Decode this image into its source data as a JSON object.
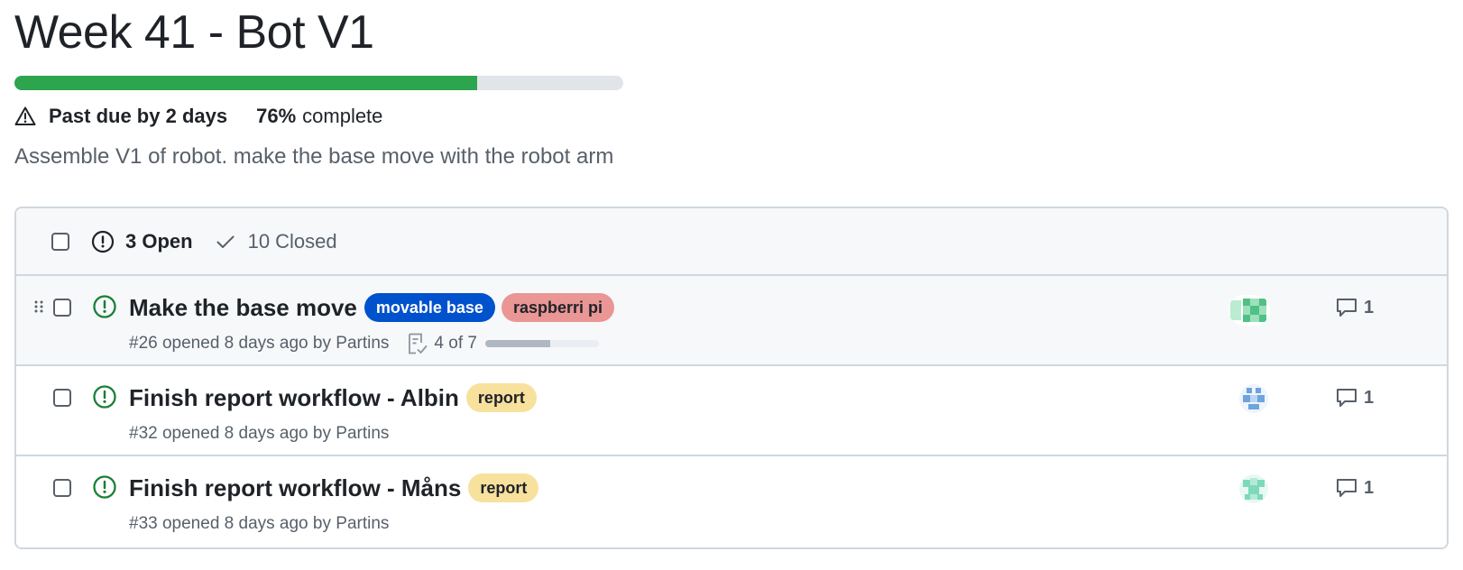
{
  "milestone": {
    "title": "Week 41 - Bot V1",
    "progress_fraction": 0.76,
    "due_status": "Past due by 2 days",
    "percent": "76%",
    "percent_suffix": "complete",
    "description": "Assemble V1 of robot. make the base move with the robot arm"
  },
  "colors": {
    "progress_green": "#2da44e",
    "open_icon_green": "#1a7f37",
    "border": "#d0d7de"
  },
  "filters": {
    "open_label": "3 Open",
    "closed_label": "10 Closed"
  },
  "issues": [
    {
      "title": "Make the base move",
      "labels": [
        {
          "text": "movable base",
          "bg": "#0052cc",
          "fg": "#ffffff"
        },
        {
          "text": "raspberri pi",
          "bg": "#e99695",
          "fg": "#1f2328"
        }
      ],
      "number": "#26",
      "meta": "opened 8 days ago by",
      "author": "Partins",
      "tasks": "4 of 7",
      "tasks_fraction": 0.571,
      "comments": "1",
      "avatar_icon": "identicon-green"
    },
    {
      "title": "Finish report workflow - Albin",
      "labels": [
        {
          "text": "report",
          "bg": "#f7e19d",
          "fg": "#1f2328"
        }
      ],
      "number": "#32",
      "meta": "opened 8 days ago by",
      "author": "Partins",
      "comments": "1",
      "avatar_icon": "identicon-blue"
    },
    {
      "title": "Finish report workflow - Måns",
      "labels": [
        {
          "text": "report",
          "bg": "#f7e19d",
          "fg": "#1f2328"
        }
      ],
      "number": "#33",
      "meta": "opened 8 days ago by",
      "author": "Partins",
      "comments": "1",
      "avatar_icon": "identicon-teal"
    }
  ]
}
